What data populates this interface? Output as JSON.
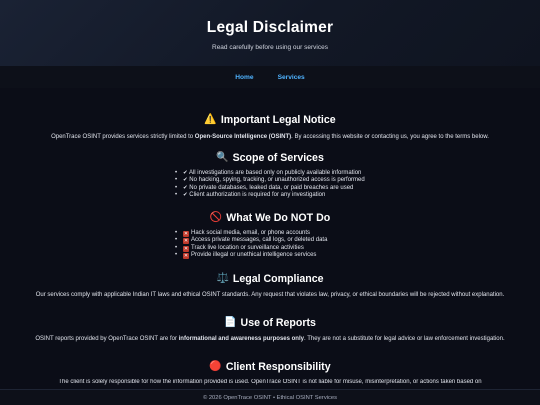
{
  "header": {
    "title": "Legal Disclaimer",
    "subtitle": "Read carefully before using our services"
  },
  "nav": {
    "items": [
      {
        "label": "Home"
      },
      {
        "label": "Services"
      }
    ]
  },
  "notice": {
    "icon": "warning-icon",
    "title": "Important Legal Notice",
    "text_before": "OpenTrace OSINT provides services strictly limited to ",
    "text_bold": "Open-Source Intelligence (OSINT)",
    "text_after": ". By accessing this website or contacting us, you agree to the terms below."
  },
  "scope": {
    "icon": "magnifier-icon",
    "title": "Scope of Services",
    "items": [
      "All investigations are based only on publicly available information",
      "No hacking, spying, tracking, or unauthorized access is performed",
      "No private databases, leaked data, or paid breaches are used",
      "Client authorization is required for any investigation"
    ]
  },
  "not_do": {
    "icon": "prohibited-icon",
    "title": "What We Do NOT Do",
    "items": [
      "Hack social media, email, or phone accounts",
      "Access private messages, call logs, or deleted data",
      "Track live location or surveillance activities",
      "Provide illegal or unethical intelligence services"
    ]
  },
  "compliance": {
    "icon": "scales-icon",
    "title": "Legal Compliance",
    "text": "Our services comply with applicable Indian IT laws and ethical OSINT standards. Any request that violates law, privacy, or ethical boundaries will be rejected without explanation."
  },
  "reports": {
    "icon": "document-icon",
    "title": "Use of Reports",
    "text_before": "OSINT reports provided by OpenTrace OSINT are for ",
    "text_bold": "informational and awareness purposes only",
    "text_after": ". They are not a substitute for legal advice or law enforcement investigation."
  },
  "client": {
    "icon": "red-circle-icon",
    "title": "Client Responsibility",
    "text": "The client is solely responsible for how the information provided is used. OpenTrace OSINT is not liable for misuse, misinterpretation, or actions taken based on"
  },
  "footer": {
    "text": "© 2026 OpenTrace OSINT • Ethical OSINT Services"
  }
}
